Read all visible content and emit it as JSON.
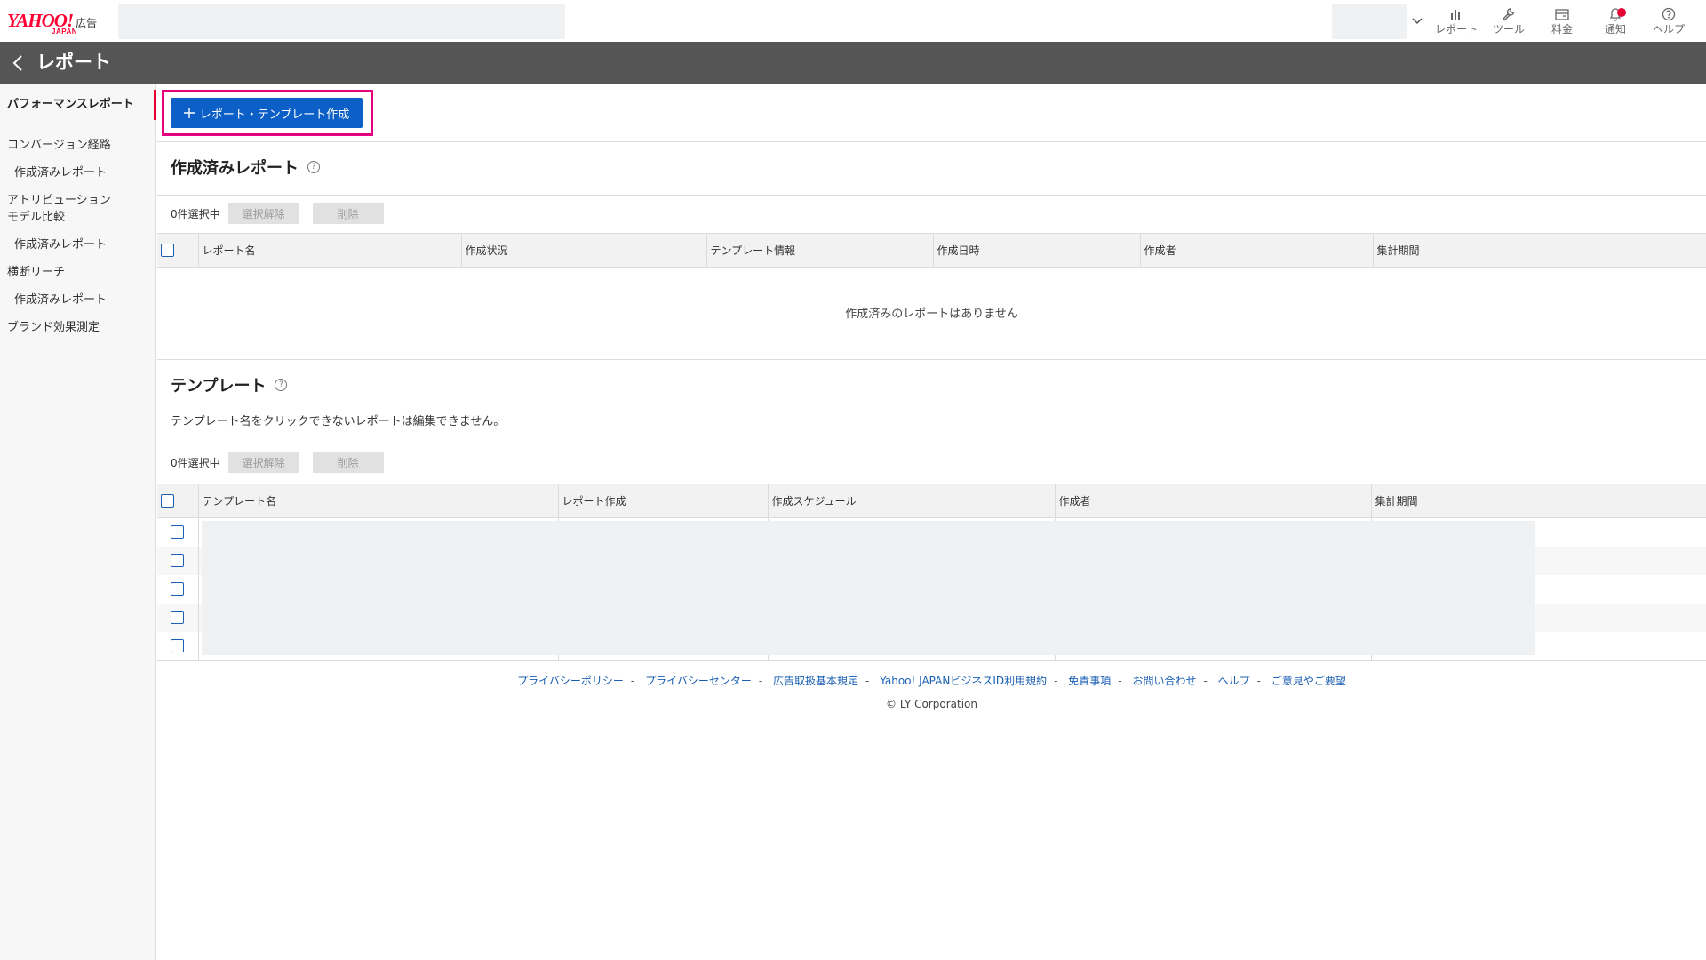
{
  "header": {
    "logo": "YAHOO!",
    "logo_sub": "JAPAN",
    "logo_ad": "広告",
    "nav": [
      {
        "label": "レポート",
        "icon": "bar-chart-icon"
      },
      {
        "label": "ツール",
        "icon": "wrench-icon"
      },
      {
        "label": "料金",
        "icon": "wallet-icon"
      },
      {
        "label": "通知",
        "icon": "bell-icon"
      },
      {
        "label": "ヘルプ",
        "icon": "help-icon"
      }
    ]
  },
  "titlebar": {
    "title": "レポート"
  },
  "sidebar": {
    "items": [
      {
        "label": "パフォーマンスレポート"
      },
      {
        "label": "コンバージョン経路"
      },
      {
        "label": "作成済みレポート"
      },
      {
        "label": "アトリビューション"
      },
      {
        "label": "モデル比較"
      },
      {
        "label": "作成済みレポート"
      },
      {
        "label": "横断リーチ"
      },
      {
        "label": "作成済みレポート"
      },
      {
        "label": "ブランド効果測定"
      }
    ]
  },
  "main": {
    "create_button": "レポート・テンプレート作成",
    "created_reports": {
      "title": "作成済みレポート",
      "selected": "0件選択中",
      "deselect": "選択解除",
      "delete": "削除",
      "columns": [
        "レポート名",
        "作成状況",
        "テンプレート情報",
        "作成日時",
        "作成者",
        "集計期間"
      ],
      "empty": "作成済みのレポートはありません"
    },
    "templates": {
      "title": "テンプレート",
      "note": "テンプレート名をクリックできないレポートは編集できません。",
      "selected": "0件選択中",
      "deselect": "選択解除",
      "delete": "削除",
      "columns": [
        "テンプレート名",
        "レポート作成",
        "作成スケジュール",
        "作成者",
        "集計期間"
      ]
    }
  },
  "footer": {
    "links": [
      "プライバシーポリシー",
      "プライバシーセンター",
      "広告取扱基本規定",
      "Yahoo! JAPANビジネスID利用規約",
      "免責事項",
      "お問い合わせ",
      "ヘルプ",
      "ご意見やご要望"
    ],
    "copyright": "© LY Corporation"
  }
}
